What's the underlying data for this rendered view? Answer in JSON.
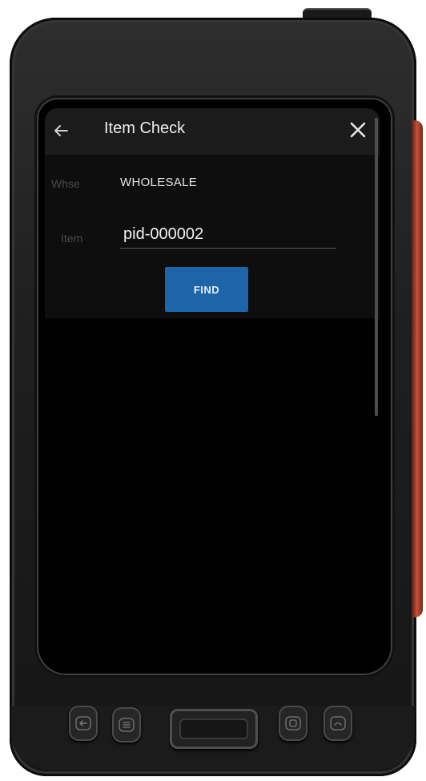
{
  "header": {
    "title": "Item Check",
    "back_icon": "arrow-left-icon",
    "close_icon": "close-icon"
  },
  "form": {
    "whse_label": "Whse",
    "whse_value": "WHOLESALE",
    "item_label": "Item",
    "item_value": "pid-000002",
    "find_label": "FIND"
  },
  "colors": {
    "accent": "#1d64a8",
    "header_bg": "#1b1b1b",
    "screen_bg": "#000000"
  },
  "hardware_keys": {
    "back": "back-key-icon",
    "menu": "menu-key-icon",
    "scan": "scan-trigger",
    "app": "app-key-icon",
    "power": "power-key-icon"
  }
}
